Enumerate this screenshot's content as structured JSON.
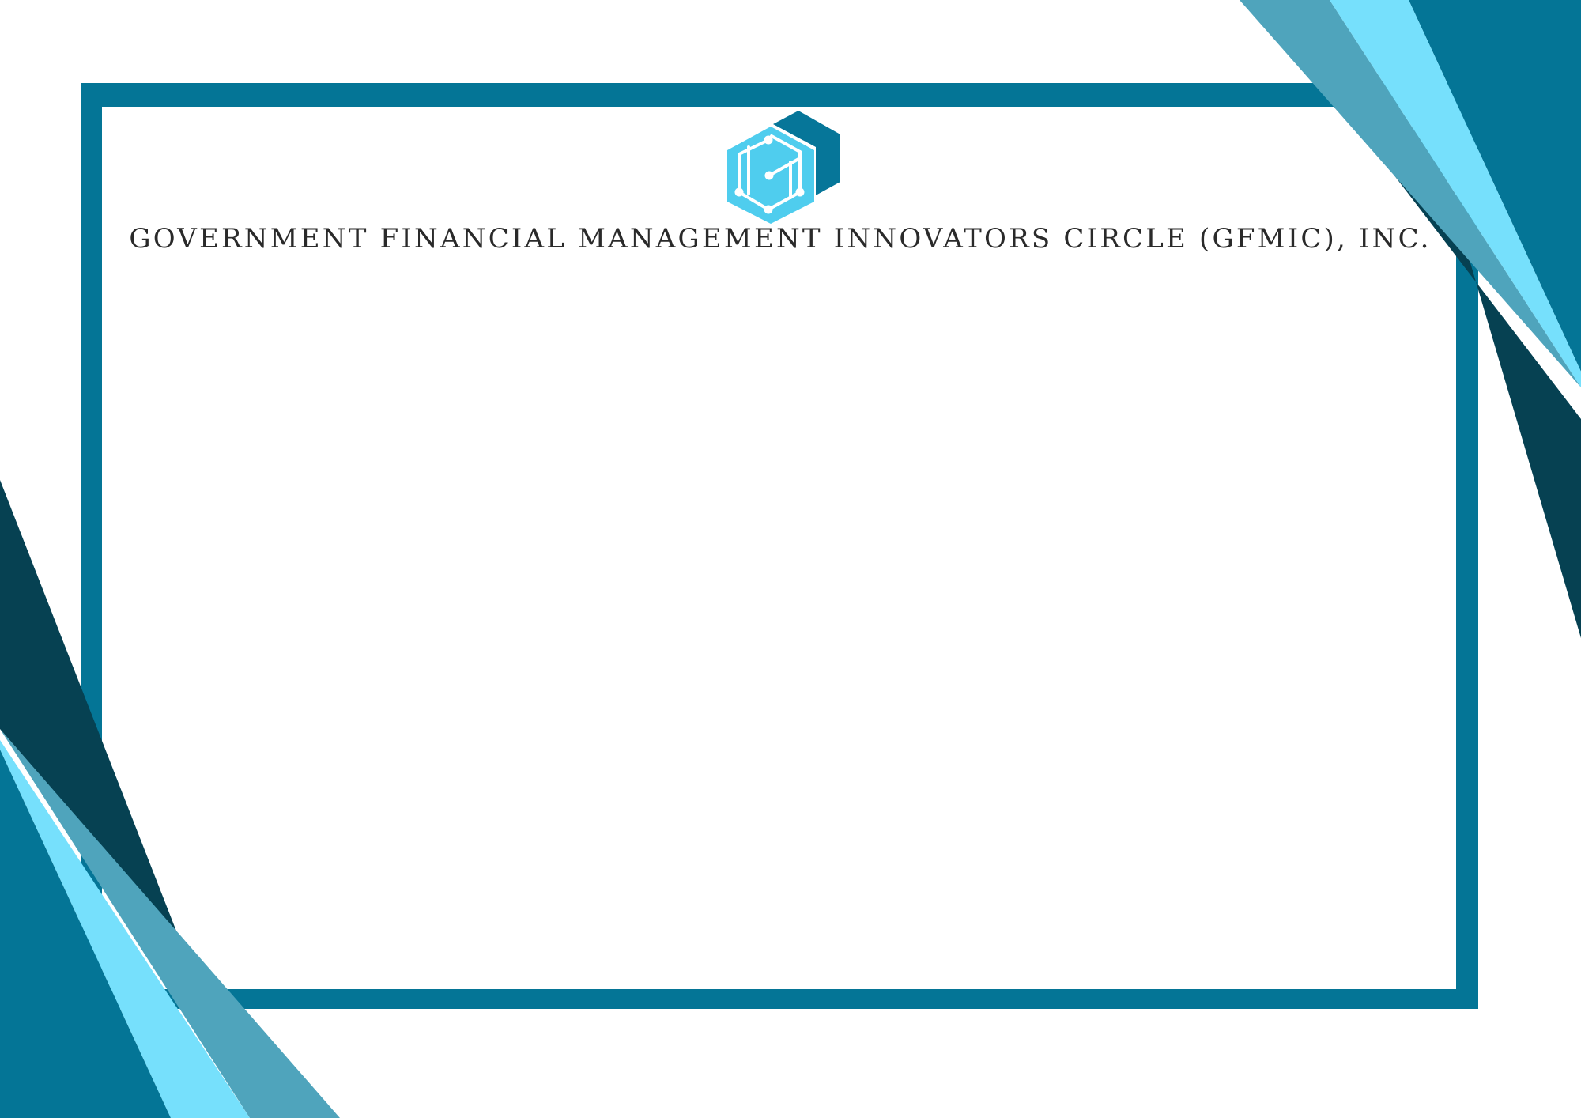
{
  "organization": {
    "name": "GOVERNMENT FINANCIAL MANAGEMENT INNOVATORS CIRCLE (GFMIC), INC.",
    "logo_icon": "hexagon-circuit-logo-icon"
  },
  "colors": {
    "frame": "#047596",
    "dark_teal": "#064152",
    "medium_teal": "#4fa4bc",
    "light_cyan": "#76e0fc",
    "logo_light": "#4fcdee",
    "logo_dark": "#067699",
    "background": "#ffffff"
  }
}
